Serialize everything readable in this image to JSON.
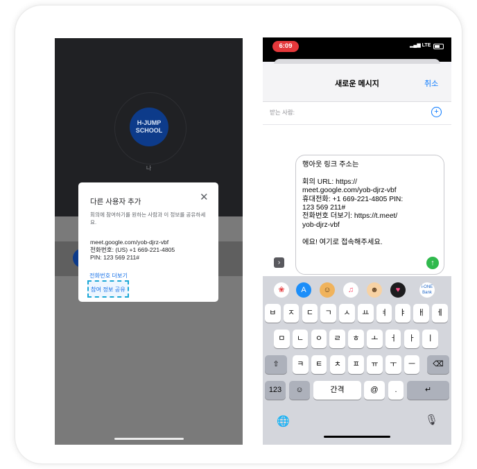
{
  "left_phone": {
    "logo_lines": [
      "H-JUMP",
      "SCHOOL"
    ],
    "self_label": "나",
    "dialog": {
      "title": "다른 사용자 추가",
      "close_icon": "close-icon",
      "description": "회의에 참여하기를 원하는 사람과 이 정보를 공유하세요.",
      "meeting_url": "meet.google.com/yob-djrz-vbf",
      "phone": "전화번호: (US) +1 669-221-4805",
      "pin": "PIN: 123 569 211#",
      "more_phone_link": "전화번호 더보기",
      "share_button": "참여 정보 공유"
    }
  },
  "right_phone": {
    "status_time": "6:09",
    "status_network": "LTE",
    "compose": {
      "title": "새로운 메시지",
      "cancel": "취소",
      "to_label": "받는 사람:",
      "message_lines": [
        "행아웃 링크 주소는",
        "",
        "회의 URL: https://",
        "meet.google.com/yob-djrz-vbf",
        "휴대전화: +1 669-221-4805 PIN:",
        "123 569 211#",
        "전화번호 더보기: https://t.meet/",
        "yob-djrz-vbf",
        "",
        "에요! 여기로 접속해주세요."
      ]
    },
    "keyboard": {
      "apps": [
        {
          "name": "photos-icon",
          "glyph": "❀",
          "color": "#ffffff",
          "fg": "#e5383b"
        },
        {
          "name": "app-store-icon",
          "glyph": "A",
          "color": "#1c8ef9",
          "fg": "#ffffff"
        },
        {
          "name": "memoji-icon",
          "glyph": "☺",
          "color": "#f0b35c",
          "fg": "#5a3a1a"
        },
        {
          "name": "music-icon",
          "glyph": "♫",
          "color": "#ffffff",
          "fg": "#fa4a6a"
        },
        {
          "name": "animoji-icon",
          "glyph": "☻",
          "color": "#f7d2a4",
          "fg": "#6a4a2a"
        },
        {
          "name": "heart-sticker-icon",
          "glyph": "♥",
          "color": "#1c1c1e",
          "fg": "#ff4f8b"
        },
        {
          "name": "ione-bank-icon",
          "glyph": "i-ONE Bank",
          "color": "#ffffff",
          "fg": "#1a63c6"
        }
      ],
      "row1": [
        "ㅂ",
        "ㅈ",
        "ㄷ",
        "ㄱ",
        "ㅅ",
        "ㅛ",
        "ㅕ",
        "ㅑ",
        "ㅐ",
        "ㅔ"
      ],
      "row2": [
        "ㅁ",
        "ㄴ",
        "ㅇ",
        "ㄹ",
        "ㅎ",
        "ㅗ",
        "ㅓ",
        "ㅏ",
        "ㅣ"
      ],
      "row3": [
        "ㅋ",
        "ㅌ",
        "ㅊ",
        "ㅍ",
        "ㅠ",
        "ㅜ",
        "ㅡ"
      ],
      "shift_icon": "⇧",
      "delete_icon": "⌫",
      "numbers_key": "123",
      "emoji_icon": "☺",
      "space_key": "간격",
      "at_key": "@",
      "dot_key": ".",
      "return_icon": "↵",
      "globe_icon": "🌐",
      "mic_icon": "🎙"
    }
  }
}
